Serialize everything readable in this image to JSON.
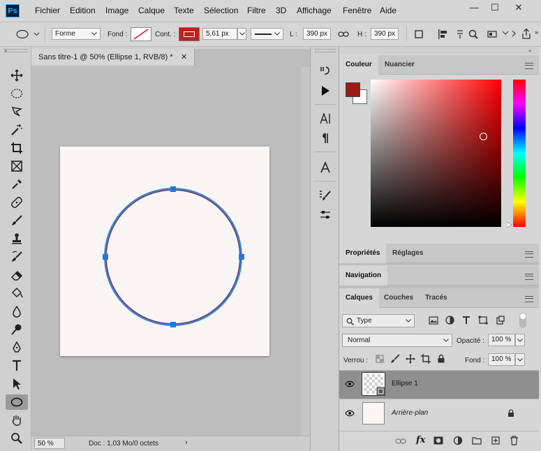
{
  "menubar": {
    "logo": "Ps",
    "items": [
      "Fichier",
      "Edition",
      "Image",
      "Calque",
      "Texte",
      "Sélection",
      "Filtre",
      "3D",
      "Affichage",
      "Fenêtre",
      "Aide"
    ],
    "window_buttons": [
      "—",
      "☐",
      "✕"
    ]
  },
  "options": {
    "mode": "Forme",
    "fill_label": "Fond :",
    "stroke_label": "Cont. :",
    "stroke_width": "5,61 px",
    "width_label": "L :",
    "width_value": "390 px",
    "height_label": "H :",
    "height_value": "390 px",
    "colors": {
      "stroke": "#c0201c"
    }
  },
  "document": {
    "tab_title": "Sans titre-1 @ 50% (Ellipse 1, RVB/8) *",
    "zoom": "50 %",
    "doc_info": "Doc : 1,03 Mo/0 octets",
    "canvas_color": "#fbf6f6",
    "ellipse_color": "#3a86d6",
    "ellipse_inner_color": "#a4262c"
  },
  "color_panel": {
    "tabs": [
      "Couleur",
      "Nuancier"
    ],
    "foreground": "#9e1b17",
    "background": "#ffffff",
    "hue": "#ff0000"
  },
  "adjust_panel": {
    "tabs": [
      "Propriétés",
      "Réglages"
    ]
  },
  "nav_panel": {
    "tabs": [
      "Navigation"
    ]
  },
  "layers_panel": {
    "tabs": [
      "Calques",
      "Couches",
      "Tracés"
    ],
    "filter_kind": "Type",
    "blend_mode": "Normal",
    "opacity_label": "Opacité :",
    "opacity_value": "100 %",
    "lock_label": "Verrou :",
    "fill_label": "Fond :",
    "fill_value": "100 %",
    "layers": [
      {
        "name": "Ellipse 1",
        "selected": true
      },
      {
        "name": "Arrière-plan",
        "selected": false,
        "locked": true
      }
    ]
  },
  "tools": [
    "move-icon",
    "ellipse-marquee-icon",
    "lasso-icon",
    "magic-wand-icon",
    "crop-icon",
    "frame-icon",
    "eyedropper-icon",
    "healing-icon",
    "brush-icon",
    "stamp-icon",
    "history-brush-icon",
    "eraser-icon",
    "paint-bucket-icon",
    "blur-icon",
    "dodge-icon",
    "pen-icon",
    "type-tool-icon",
    "path-select-icon",
    "ellipse-tool-icon",
    "hand-icon",
    "zoom-icon"
  ]
}
